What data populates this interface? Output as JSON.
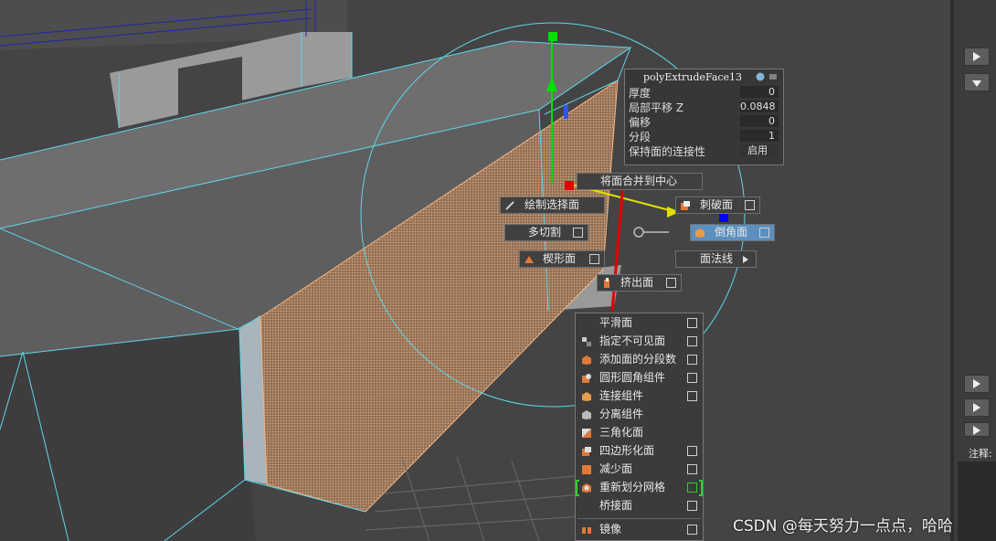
{
  "attr_panel": {
    "title": "polyExtrudeFace13",
    "rows": [
      {
        "label": "厚度",
        "value": "0"
      },
      {
        "label": "局部平移 Z",
        "value": "0.0848"
      },
      {
        "label": "偏移",
        "value": "0"
      },
      {
        "label": "分段",
        "value": "1"
      },
      {
        "label": "保持面的连接性",
        "value": "启用"
      }
    ]
  },
  "marking_menu": {
    "north": "将面合并到中心",
    "northwest": "绘制选择面",
    "northeast": "刺破面",
    "west": "多切割",
    "east": "倒角面",
    "southwest": "楔形面",
    "southeast": "面法线",
    "south": "挤出面"
  },
  "list_menu": {
    "items": [
      {
        "label": "平滑面",
        "icon": "none-icon",
        "checkbox": true
      },
      {
        "label": "指定不可见面",
        "icon": "invisible-faces-icon",
        "checkbox": true
      },
      {
        "label": "添加面的分段数",
        "icon": "add-divisions-icon",
        "checkbox": true
      },
      {
        "label": "圆形圆角组件",
        "icon": "circularize-icon",
        "checkbox": true
      },
      {
        "label": "连接组件",
        "icon": "connect-icon",
        "checkbox": true
      },
      {
        "label": "分离组件",
        "icon": "detach-icon",
        "checkbox": false
      },
      {
        "label": "三角化面",
        "icon": "triangulate-icon",
        "checkbox": false
      },
      {
        "label": "四边形化面",
        "icon": "quadrangulate-icon",
        "checkbox": true
      },
      {
        "label": "减少面",
        "icon": "reduce-icon",
        "checkbox": true
      },
      {
        "label": "重新划分网格",
        "icon": "remesh-icon",
        "checkbox": true
      },
      {
        "label": "桥接面",
        "icon": "none-icon",
        "checkbox": true
      },
      {
        "label": "镜像",
        "icon": "mirror-icon",
        "checkbox": true
      }
    ]
  },
  "side_panel": {
    "notes_label": "注释:"
  },
  "watermark": "CSDN @每天努力一点点，哈哈",
  "colors": {
    "viewport_bg": "#444444",
    "wire": "#5fd6ea",
    "selected_face": "#e8a36a",
    "highlight": "#5a8fbf",
    "axis_y": "#00e000",
    "axis_x": "#e00000",
    "axis_z": "#0000ff"
  }
}
